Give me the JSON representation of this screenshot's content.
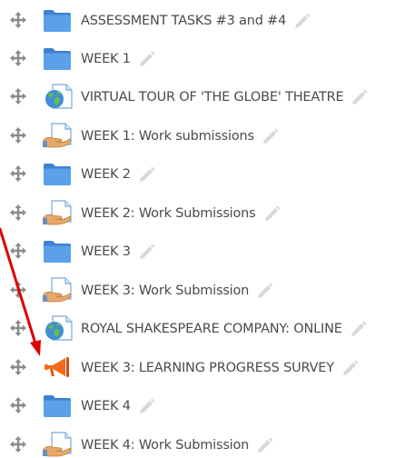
{
  "items": [
    {
      "label": "ASSESSMENT TASKS #3 and #4",
      "type": "folder-icon"
    },
    {
      "label": "WEEK 1",
      "type": "folder-icon"
    },
    {
      "label": "VIRTUAL TOUR OF 'THE GLOBE' THEATRE",
      "type": "url-globe-icon"
    },
    {
      "label": "WEEK 1: Work submissions",
      "type": "assignment-icon"
    },
    {
      "label": "WEEK 2",
      "type": "folder-icon"
    },
    {
      "label": "WEEK 2: Work Submissions",
      "type": "assignment-icon"
    },
    {
      "label": "WEEK 3",
      "type": "folder-icon"
    },
    {
      "label": "WEEK 3: Work Submission",
      "type": "assignment-icon"
    },
    {
      "label": "ROYAL SHAKESPEARE COMPANY: ONLINE",
      "type": "url-globe-icon"
    },
    {
      "label": "WEEK 3: LEARNING PROGRESS SURVEY",
      "type": "megaphone-icon"
    },
    {
      "label": "WEEK 4",
      "type": "folder-icon"
    },
    {
      "label": "WEEK 4: Work Submission",
      "type": "assignment-icon"
    }
  ],
  "colors": {
    "folder": "#4a8fd8",
    "text": "#4a4a4a",
    "move_icon": "#8a8a8a",
    "edit_icon": "#d8d8d8",
    "arrow": "#e00000",
    "megaphone": "#f26a1b"
  }
}
